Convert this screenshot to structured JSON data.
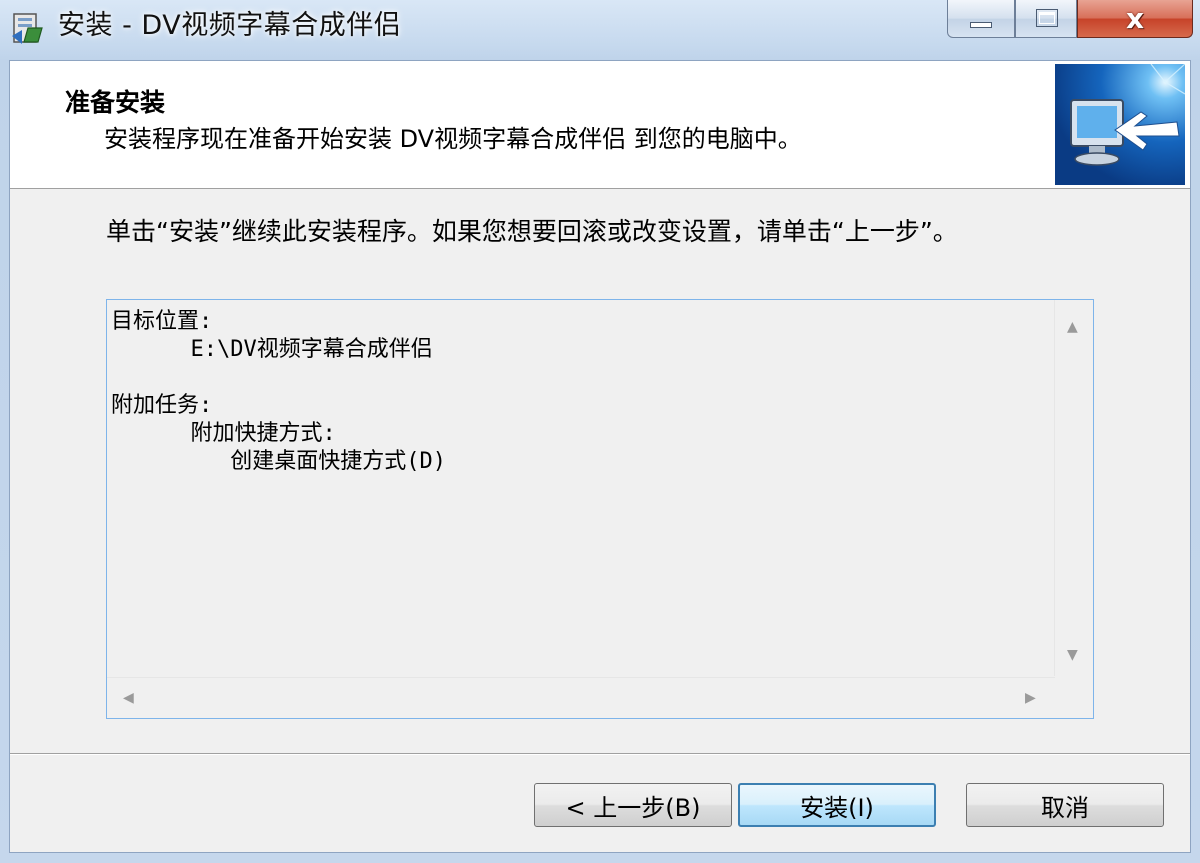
{
  "window": {
    "title": "安装 - DV视频字幕合成伴侣",
    "controls": {
      "minimize_icon": "minimize-icon",
      "maximize_icon": "maximize-icon",
      "close_icon": "close-icon",
      "close_glyph": "x"
    }
  },
  "header": {
    "title": "准备安装",
    "subtitle": "安装程序现在准备开始安装 DV视频字幕合成伴侣 到您的电脑中。",
    "image_icon": "computer-install-icon"
  },
  "body": {
    "instruction": "单击“安装”继续此安装程序。如果您想要回滚或改变设置，请单击“上一步”。"
  },
  "memo": {
    "lines": [
      "目标位置:",
      "      E:\\DV视频字幕合成伴侣",
      "",
      "附加任务:",
      "      附加快捷方式:",
      "         创建桌面快捷方式(D)"
    ]
  },
  "buttons": {
    "back": "< 上一步(B)",
    "install": "安装(I)",
    "cancel": "取消"
  },
  "colors": {
    "title_bar": "#c6d9ee",
    "close_button": "#c7432a",
    "memo_border": "#7eb4ea",
    "default_button_border": "#3c7fb1"
  }
}
